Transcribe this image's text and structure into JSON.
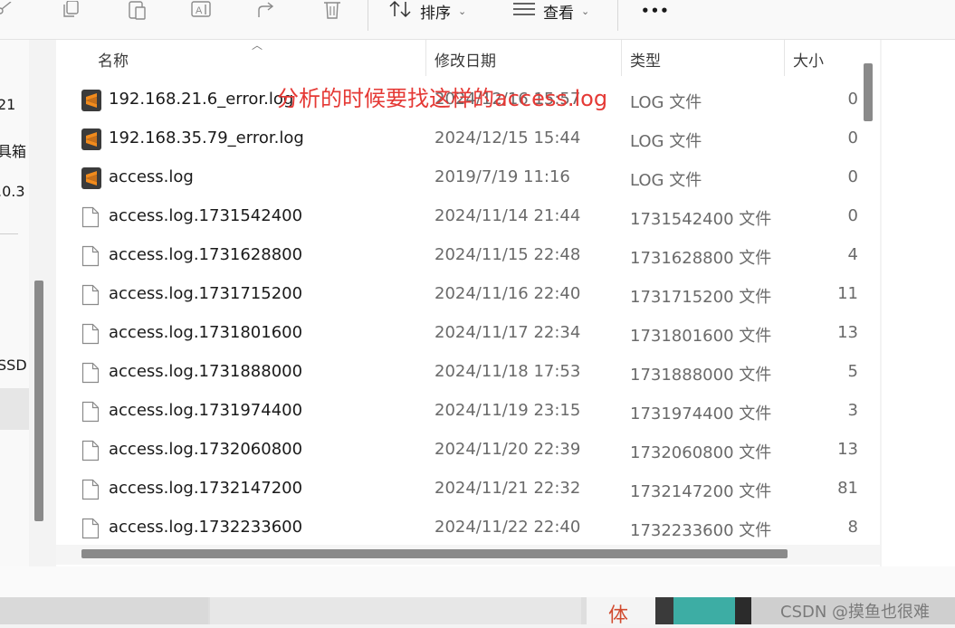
{
  "toolbar": {
    "sort_label": "排序",
    "view_label": "查看",
    "more_label": "•••"
  },
  "nav": {
    "items": [
      "21",
      "具箱",
      ".0.3",
      "SSD"
    ]
  },
  "columns": {
    "name": "名称",
    "date": "修改日期",
    "type": "类型",
    "size": "大小"
  },
  "annotation": "分析的时候要找这样的access.log",
  "files": [
    {
      "name": "192.168.21.6_error.log",
      "date": "2024/12/16 15:57",
      "type": "LOG 文件",
      "size": "0",
      "icon": "sublime-icon"
    },
    {
      "name": "192.168.35.79_error.log",
      "date": "2024/12/15 15:44",
      "type": "LOG 文件",
      "size": "0",
      "icon": "sublime-icon"
    },
    {
      "name": "access.log",
      "date": "2019/7/19 11:16",
      "type": "LOG 文件",
      "size": "0",
      "icon": "sublime-icon"
    },
    {
      "name": "access.log.1731542400",
      "date": "2024/11/14 21:44",
      "type": "1731542400 文件",
      "size": "0",
      "icon": "file-icon"
    },
    {
      "name": "access.log.1731628800",
      "date": "2024/11/15 22:48",
      "type": "1731628800 文件",
      "size": "4",
      "icon": "file-icon"
    },
    {
      "name": "access.log.1731715200",
      "date": "2024/11/16 22:40",
      "type": "1731715200 文件",
      "size": "11",
      "icon": "file-icon"
    },
    {
      "name": "access.log.1731801600",
      "date": "2024/11/17 22:34",
      "type": "1731801600 文件",
      "size": "13",
      "icon": "file-icon"
    },
    {
      "name": "access.log.1731888000",
      "date": "2024/11/18 17:53",
      "type": "1731888000 文件",
      "size": "5",
      "icon": "file-icon"
    },
    {
      "name": "access.log.1731974400",
      "date": "2024/11/19 23:15",
      "type": "1731974400 文件",
      "size": "3",
      "icon": "file-icon"
    },
    {
      "name": "access.log.1732060800",
      "date": "2024/11/20 22:39",
      "type": "1732060800 文件",
      "size": "13",
      "icon": "file-icon"
    },
    {
      "name": "access.log.1732147200",
      "date": "2024/11/21 22:32",
      "type": "1732147200 文件",
      "size": "81",
      "icon": "file-icon"
    },
    {
      "name": "access.log.1732233600",
      "date": "2024/11/22 22:40",
      "type": "1732233600 文件",
      "size": "8",
      "icon": "file-icon"
    }
  ],
  "taskbar": {
    "char": "体",
    "watermark": "CSDN @摸鱼也很难"
  },
  "colors": {
    "annotation": "#e53935",
    "sublime_orange": "#f28b1c",
    "sublime_dark": "#3b3b3b"
  }
}
